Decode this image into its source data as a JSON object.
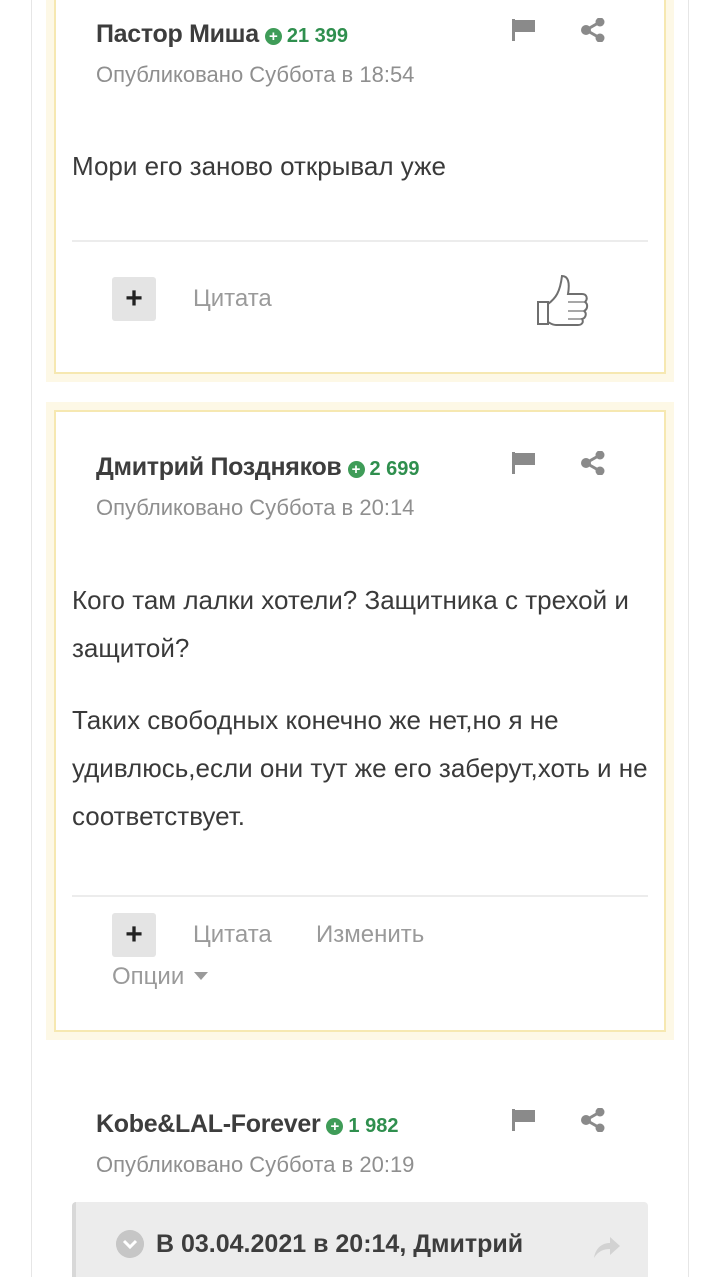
{
  "posts": [
    {
      "author": "Пастор Миша",
      "reputation": "21 399",
      "published": "Опубликовано Суббота в 18:54",
      "paragraphs": [
        "Мори его заново открывал уже"
      ],
      "actions": {
        "quote": "Цитата"
      }
    },
    {
      "author": "Дмитрий Поздняков",
      "reputation": "2 699",
      "published": "Опубликовано Суббота в 20:14",
      "paragraphs": [
        "Кого там лалки хотели? Защитника с трехой и защитой?",
        "Таких свободных конечно же нет,но я не удивлюсь,если они тут же его заберут,хоть и не соответствует."
      ],
      "actions": {
        "quote": "Цитата",
        "edit": "Изменить",
        "options": "Опции"
      }
    },
    {
      "author": "Kobe&LAL-Forever",
      "reputation": "1 982",
      "published": "Опубликовано Суббота в 20:19",
      "quote_header": "В 03.04.2021 в 20:14, Дмитрий"
    }
  ],
  "icons": {
    "reputation": "plus-circle-icon",
    "report": "flag-icon",
    "share": "share-icon",
    "multiquote": "plus-icon",
    "like": "thumbs-up-icon",
    "expand": "chevron-down-icon",
    "goto": "arrow-forward-icon"
  },
  "colors": {
    "highlight_bg": "#fdf8e6",
    "highlight_border": "#f6e8b1",
    "reputation": "#2f8f4e",
    "muted_text": "#8f8f8f"
  }
}
